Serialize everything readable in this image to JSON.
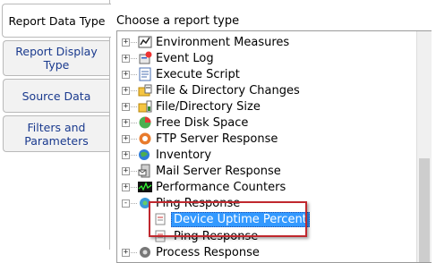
{
  "tabs": [
    {
      "label": "Report Data Type",
      "active": true
    },
    {
      "label": "Report Display Type",
      "active": false
    },
    {
      "label": "Source Data",
      "active": false
    },
    {
      "label": "Filters and Parameters",
      "active": false
    }
  ],
  "panel": {
    "title": "Choose a report type"
  },
  "tree": {
    "items": [
      {
        "label": "Environment Measures",
        "icon": "environment-icon",
        "expander": "+"
      },
      {
        "label": "Event Log",
        "icon": "event-log-icon",
        "expander": "+"
      },
      {
        "label": "Execute Script",
        "icon": "script-icon",
        "expander": "+"
      },
      {
        "label": "File & Directory Changes",
        "icon": "folder-changes-icon",
        "expander": "+"
      },
      {
        "label": "File/Directory Size",
        "icon": "folder-size-icon",
        "expander": "+"
      },
      {
        "label": "Free Disk Space",
        "icon": "disk-icon",
        "expander": "+"
      },
      {
        "label": "FTP Server Response",
        "icon": "ftp-icon",
        "expander": "+"
      },
      {
        "label": "Inventory",
        "icon": "inventory-icon",
        "expander": "+"
      },
      {
        "label": "Mail Server Response",
        "icon": "mail-server-icon",
        "expander": "+"
      },
      {
        "label": "Performance Counters",
        "icon": "performance-icon",
        "expander": "+"
      },
      {
        "label": "Ping Response",
        "icon": "ping-icon",
        "expander": "-"
      }
    ],
    "children": [
      {
        "label": "Device Uptime Percent",
        "icon": "report-icon",
        "selected": true
      },
      {
        "label": "Ping Response",
        "icon": "report-icon",
        "selected": false
      }
    ],
    "partial_next": {
      "label": "Process Response",
      "icon": "process-icon",
      "expander": "+"
    }
  },
  "colors": {
    "selection": "#3399ff",
    "highlight_border": "#c0282e",
    "tab_text": "#1a3a8e"
  }
}
